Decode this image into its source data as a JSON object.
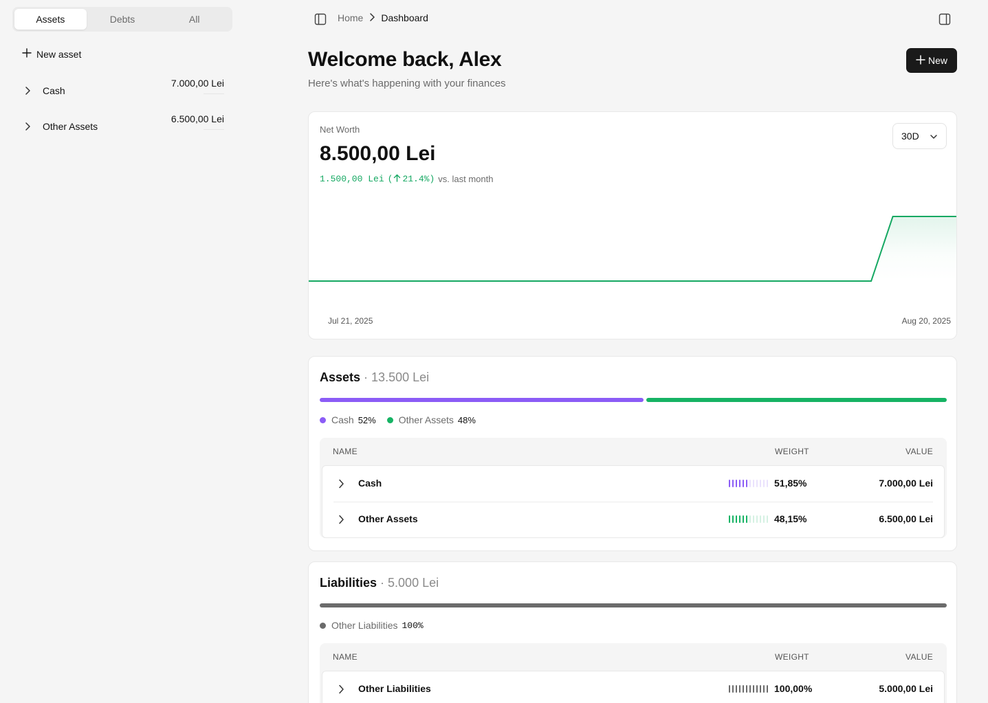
{
  "sidebar": {
    "tabs": [
      {
        "label": "Assets",
        "active": true
      },
      {
        "label": "Debts",
        "active": false
      },
      {
        "label": "All",
        "active": false
      }
    ],
    "new_asset_label": "New asset",
    "accounts": [
      {
        "name": "Cash",
        "value": "7.000,00 Lei"
      },
      {
        "name": "Other Assets",
        "value": "6.500,00 Lei"
      }
    ]
  },
  "topbar": {
    "breadcrumb_home": "Home",
    "breadcrumb_current": "Dashboard"
  },
  "header": {
    "title": "Welcome back, Alex",
    "subtitle": "Here's what's happening with your finances",
    "new_button": "New"
  },
  "net_worth": {
    "label": "Net Worth",
    "value": "8.500,00 Lei",
    "change_amount": "1.500,00 Lei",
    "change_pct": "21.4%",
    "change_suffix": "vs. last month",
    "period": "30D",
    "x_start": "Jul 21, 2025",
    "x_end": "Aug 20, 2025",
    "color": "#15a862"
  },
  "chart_data": {
    "type": "area",
    "title": "",
    "xlabel": "",
    "ylabel": "",
    "x": [
      "Jul 21, 2025",
      "Aug 16, 2025",
      "Aug 17, 2025",
      "Aug 20, 2025"
    ],
    "series": [
      {
        "values": [
          7000,
          7000,
          8500,
          8500
        ]
      }
    ],
    "ylim": [
      6000,
      9000
    ],
    "grid": false
  },
  "assets": {
    "title": "Assets",
    "total": "13.500 Lei",
    "bars": [
      {
        "name": "Cash",
        "fraction": 0.5185,
        "color": "#8b5cf6"
      },
      {
        "name": "Other Assets",
        "fraction": 0.4815,
        "color": "#16b364"
      }
    ],
    "legend": [
      {
        "name": "Cash",
        "pct": "52%",
        "color": "#8b5cf6"
      },
      {
        "name": "Other Assets",
        "pct": "48%",
        "color": "#16b364"
      }
    ],
    "columns": {
      "name": "NAME",
      "weight": "WEIGHT",
      "value": "VALUE"
    },
    "rows": [
      {
        "name": "Cash",
        "weight": "51,85%",
        "value": "7.000,00 Lei",
        "weight_fraction": 0.5185,
        "color": "#8b5cf6"
      },
      {
        "name": "Other Assets",
        "weight": "48,15%",
        "value": "6.500,00 Lei",
        "weight_fraction": 0.4815,
        "color": "#16b364"
      }
    ]
  },
  "liabilities": {
    "title": "Liabilities",
    "total": "5.000 Lei",
    "bars": [
      {
        "name": "Other Liabilities",
        "fraction": 1.0,
        "color": "#6b6b6b"
      }
    ],
    "legend": [
      {
        "name": "Other Liabilities",
        "pct": "100%",
        "color": "#6b6b6b"
      }
    ],
    "columns": {
      "name": "NAME",
      "weight": "WEIGHT",
      "value": "VALUE"
    },
    "rows": [
      {
        "name": "Other Liabilities",
        "weight": "100,00%",
        "value": "5.000,00 Lei",
        "weight_fraction": 1.0,
        "color": "#6b6b6b"
      }
    ]
  }
}
